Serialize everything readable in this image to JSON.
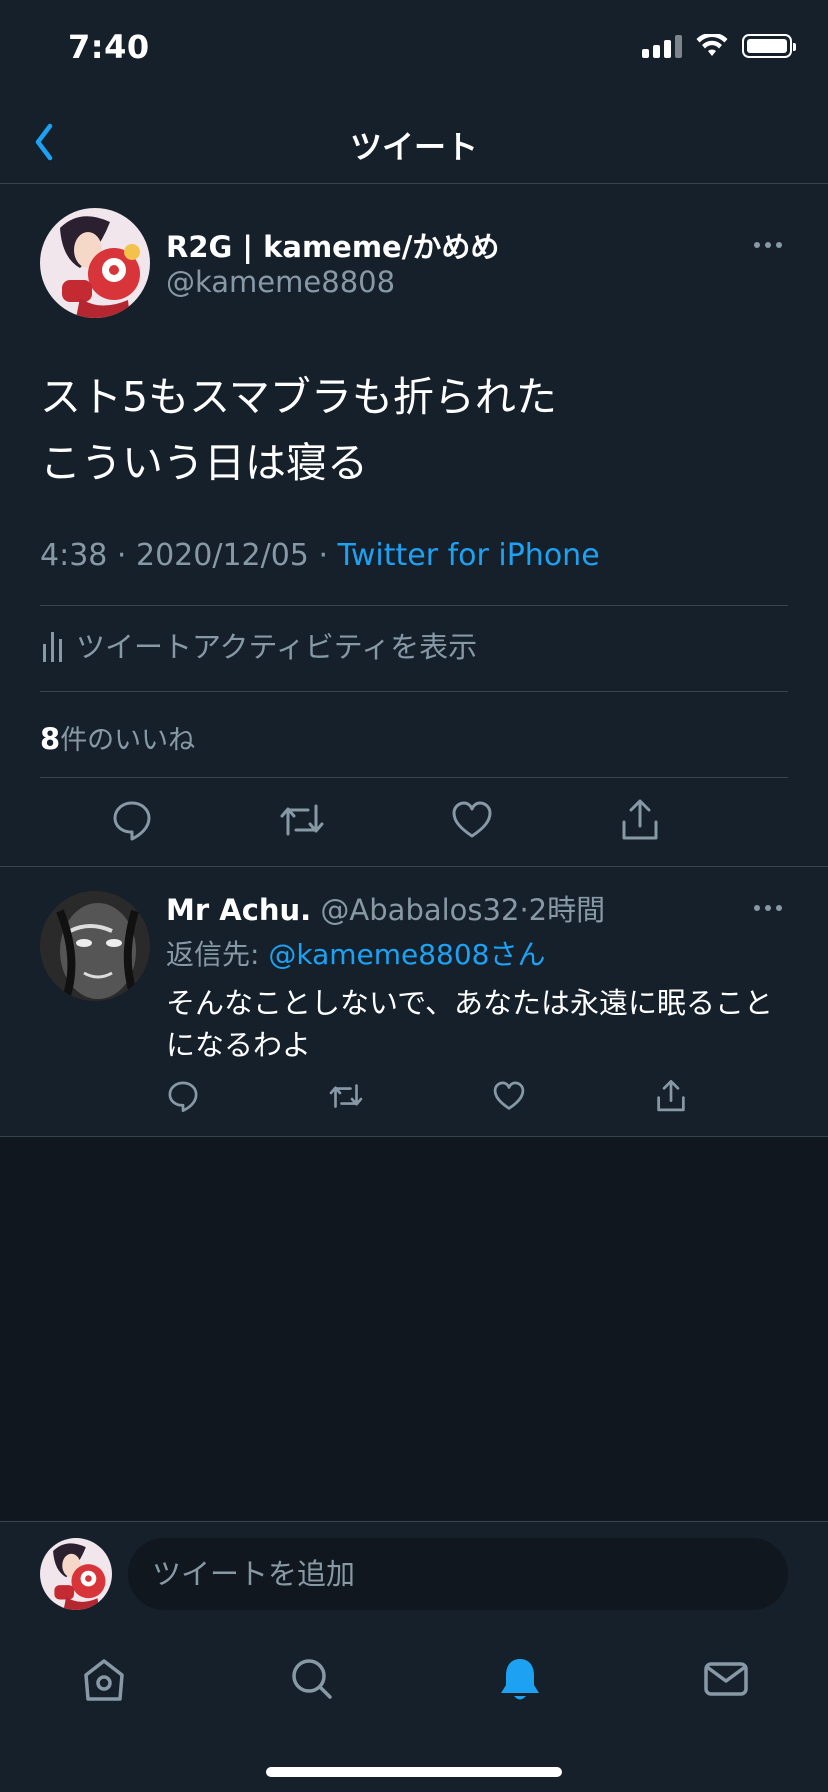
{
  "status_bar": {
    "time": "7:40"
  },
  "header": {
    "title": "ツイート"
  },
  "tweet": {
    "author_name": "R2G | kameme/かめめ",
    "author_handle": "@kameme8808",
    "text_line1": "スト5もスマブラも折られた",
    "text_line2": "こういう日は寝る",
    "time": "4:38",
    "separator": " · ",
    "date": "2020/12/05",
    "source": "Twitter for iPhone",
    "activity_label": "ツイートアクティビティを表示",
    "likes_count": "8",
    "likes_label": "件のいいね"
  },
  "reply": {
    "name": "Mr Achu.",
    "handle": "@Ababalos32",
    "separator": "·",
    "time": "2時間",
    "reply_to_label": "返信先: ",
    "reply_to_mention": "@kameme8808さん",
    "text": "そんなことしないで、あなたは永遠に眠ることになるわよ"
  },
  "compose": {
    "placeholder": "ツイートを追加"
  },
  "icons": {
    "back": "chevron-left-icon",
    "more": "more-horizontal-icon",
    "reply": "comment-icon",
    "retweet": "retweet-icon",
    "like": "heart-icon",
    "share": "share-icon",
    "home": "home-icon",
    "search": "search-icon",
    "notifications": "bell-icon",
    "messages": "mail-icon"
  },
  "colors": {
    "background": "#15202b",
    "accent": "#1da1f2",
    "secondary_text": "#8899a6",
    "divider": "#38444d"
  }
}
